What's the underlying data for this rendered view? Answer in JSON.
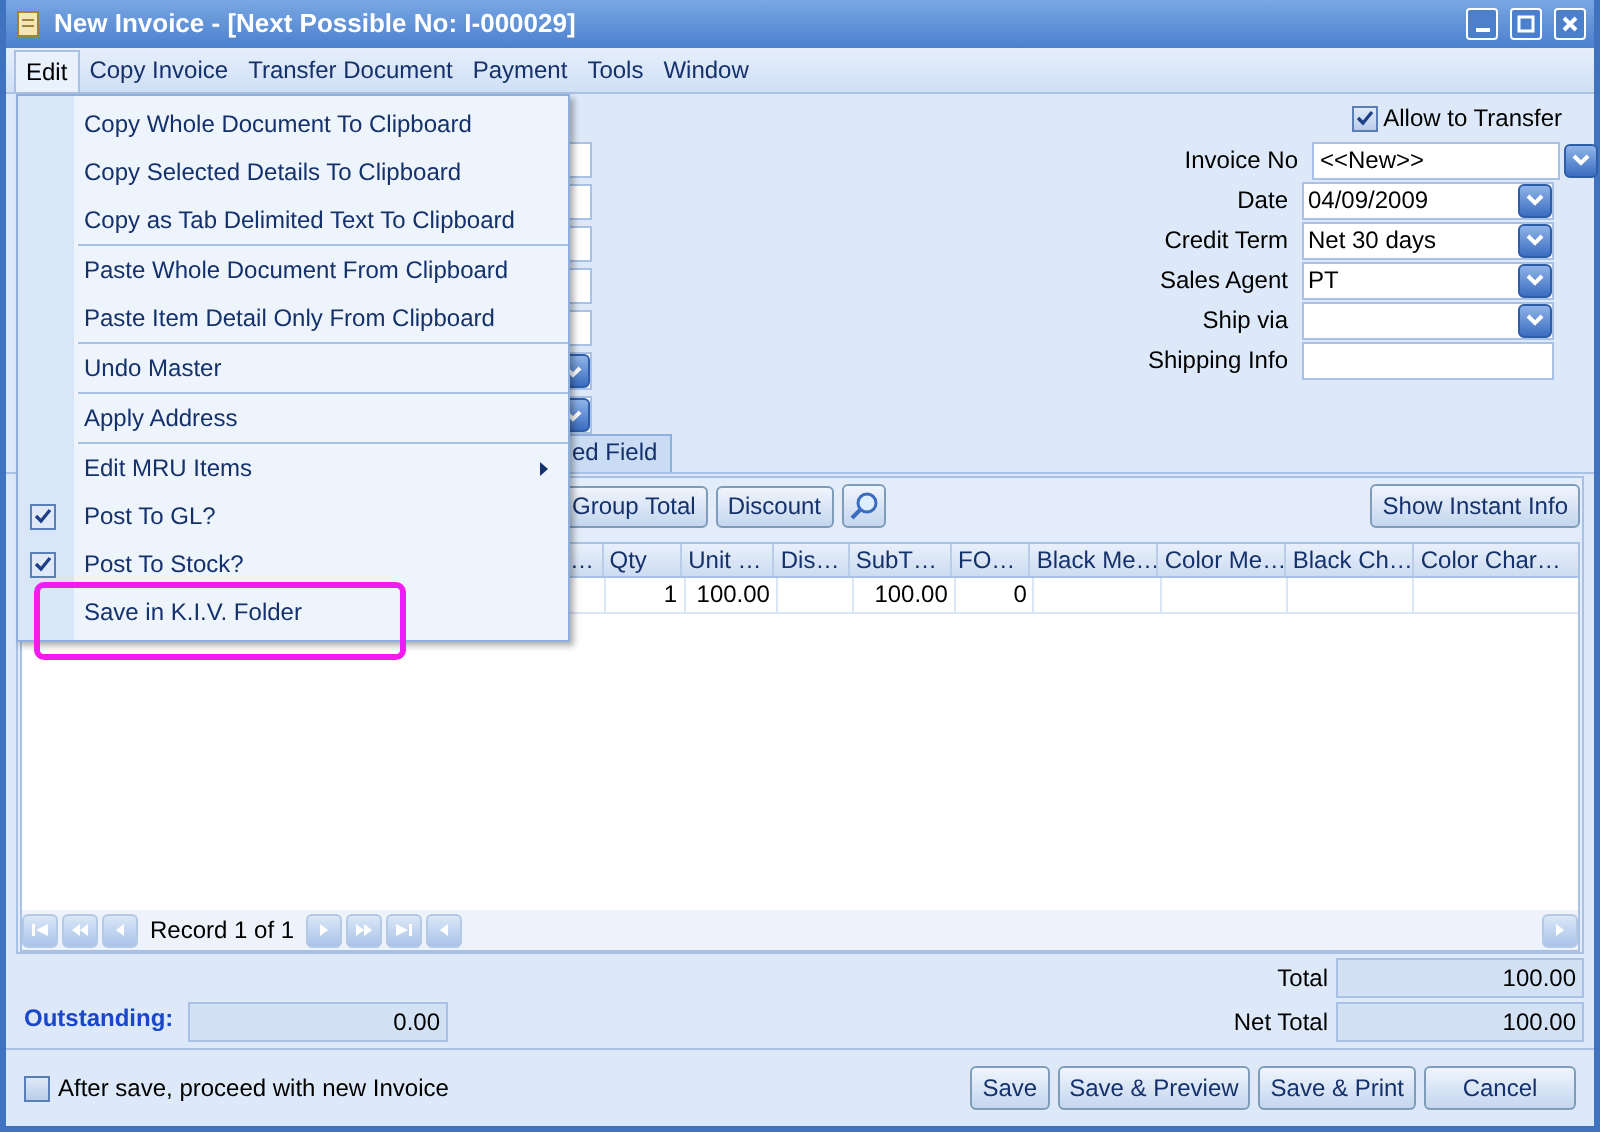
{
  "window": {
    "title": "New Invoice - [Next Possible No: I-000029]"
  },
  "menu_bar": [
    {
      "label": "Edit",
      "selected": true
    },
    {
      "label": "Copy Invoice",
      "selected": false
    },
    {
      "label": "Transfer Document",
      "selected": false
    },
    {
      "label": "Payment",
      "selected": false
    },
    {
      "label": "Tools",
      "selected": false
    },
    {
      "label": "Window",
      "selected": false
    }
  ],
  "edit_menu": {
    "items": [
      {
        "kind": "item",
        "label": "Copy Whole Document To Clipboard"
      },
      {
        "kind": "item",
        "label": "Copy Selected Details To Clipboard"
      },
      {
        "kind": "item",
        "label": "Copy as Tab Delimited Text To Clipboard"
      },
      {
        "kind": "separator"
      },
      {
        "kind": "item",
        "label": "Paste Whole Document From Clipboard"
      },
      {
        "kind": "item",
        "label": "Paste Item Detail Only From Clipboard"
      },
      {
        "kind": "separator"
      },
      {
        "kind": "item",
        "label": "Undo Master"
      },
      {
        "kind": "separator"
      },
      {
        "kind": "item",
        "label": "Apply Address"
      },
      {
        "kind": "separator"
      },
      {
        "kind": "submenu",
        "label": "Edit MRU Items"
      },
      {
        "kind": "check",
        "label": "Post To GL?",
        "checked": true
      },
      {
        "kind": "check",
        "label": "Post To Stock?",
        "checked": true
      },
      {
        "kind": "item",
        "label": "Save in K.I.V. Folder"
      }
    ]
  },
  "header": {
    "allow_to_transfer": {
      "label": "Allow to Transfer",
      "checked": true
    },
    "fields": [
      {
        "kind": "lookup",
        "label": "Invoice No",
        "value": "<<New>>"
      },
      {
        "kind": "combo",
        "label": "Date",
        "value": "04/09/2009"
      },
      {
        "kind": "combo",
        "label": "Credit Term",
        "value": "Net 30 days"
      },
      {
        "kind": "combo",
        "label": "Sales Agent",
        "value": "PT"
      },
      {
        "kind": "combo",
        "label": "Ship via"
      },
      {
        "kind": "text",
        "label": "Shipping Info"
      }
    ]
  },
  "tab": {
    "label": "ed Field"
  },
  "toolbar": {
    "buttons": [
      "Group Total",
      "Discount"
    ],
    "instant_info": "Show Instant Info"
  },
  "grid": {
    "columns": [
      "…",
      "Qty",
      "Unit …",
      "Dis…",
      "SubT…",
      "FO…",
      "Black Me…",
      "Color Me…",
      "Black Ch…",
      "Color Char…"
    ],
    "rows": [
      [
        null,
        "1",
        "100.00",
        null,
        "100.00",
        "0",
        null,
        null,
        null,
        null
      ]
    ]
  },
  "navigator": {
    "record": "Record 1 of 1"
  },
  "totals": {
    "outstanding_label": "Outstanding:",
    "outstanding": "0.00",
    "rows": [
      {
        "label": "Total",
        "value": "100.00"
      },
      {
        "label": "Net Total",
        "value": "100.00"
      }
    ]
  },
  "footer": {
    "proceed": {
      "label": "After save, proceed with new Invoice",
      "checked": false
    },
    "buttons": [
      "Save",
      "Save & Preview",
      "Save & Print",
      "Cancel"
    ]
  }
}
